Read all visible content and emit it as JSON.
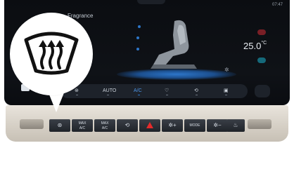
{
  "screen": {
    "time": "07:47",
    "fragrance_label": "Fragrance",
    "temperature": "25.0",
    "temperature_unit": "°C",
    "controls": [
      "AUTO",
      "A/C"
    ]
  },
  "panel": {
    "buttons": [
      {
        "name": "rear-defrost",
        "label": ""
      },
      {
        "name": "max-front-defrost",
        "label1": "MAX",
        "label2": "A/C"
      },
      {
        "name": "front-defrost",
        "label1": "MAX",
        "label2": "A/C"
      },
      {
        "name": "recirculation",
        "label": ""
      },
      {
        "name": "hazard",
        "label": ""
      },
      {
        "name": "fan-plus",
        "label": ""
      },
      {
        "name": "mode",
        "label": "MODE"
      },
      {
        "name": "fan-minus",
        "label": ""
      },
      {
        "name": "seat-heat",
        "label": ""
      }
    ]
  },
  "callout": {
    "icon": "rear-window-defroster-icon"
  },
  "colors": {
    "accent_blue": "#2d76c9",
    "hazard_red": "#e52b2b",
    "temp_up": "#7a1f26",
    "temp_down": "#15697a"
  }
}
